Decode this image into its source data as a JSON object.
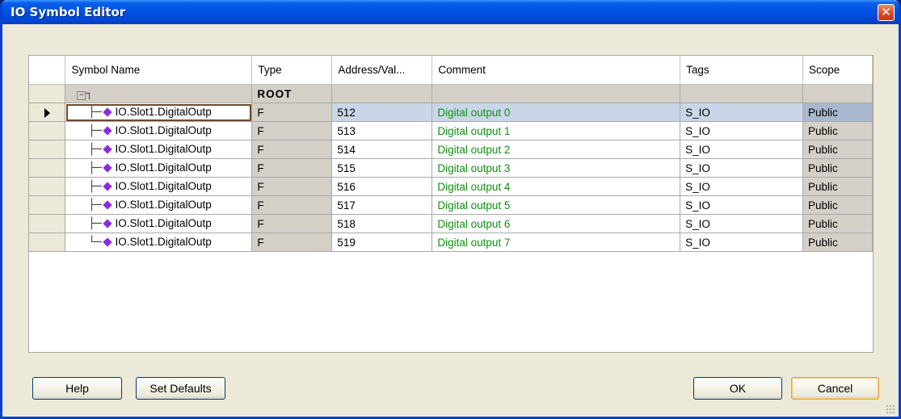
{
  "window": {
    "title": "IO Symbol Editor",
    "close_glyph": "✕"
  },
  "columns": [
    "Symbol Name",
    "Type",
    "Address/Val...",
    "Comment",
    "Tags",
    "Scope"
  ],
  "root": {
    "type": "ROOT",
    "expander_icon": "tree-collapse-icon"
  },
  "rows": [
    {
      "name": "IO.Slot1.DigitalOutp",
      "type": "F",
      "address": "512",
      "comment": "Digital output 0",
      "tags": "S_IO",
      "scope": "Public",
      "selected": true
    },
    {
      "name": "IO.Slot1.DigitalOutp",
      "type": "F",
      "address": "513",
      "comment": "Digital output 1",
      "tags": "S_IO",
      "scope": "Public"
    },
    {
      "name": "IO.Slot1.DigitalOutp",
      "type": "F",
      "address": "514",
      "comment": "Digital output 2",
      "tags": "S_IO",
      "scope": "Public"
    },
    {
      "name": "IO.Slot1.DigitalOutp",
      "type": "F",
      "address": "515",
      "comment": "Digital output 3",
      "tags": "S_IO",
      "scope": "Public"
    },
    {
      "name": "IO.Slot1.DigitalOutp",
      "type": "F",
      "address": "516",
      "comment": "Digital output 4",
      "tags": "S_IO",
      "scope": "Public"
    },
    {
      "name": "IO.Slot1.DigitalOutp",
      "type": "F",
      "address": "517",
      "comment": "Digital output 5",
      "tags": "S_IO",
      "scope": "Public"
    },
    {
      "name": "IO.Slot1.DigitalOutp",
      "type": "F",
      "address": "518",
      "comment": "Digital output 6",
      "tags": "S_IO",
      "scope": "Public"
    },
    {
      "name": "IO.Slot1.DigitalOutp",
      "type": "F",
      "address": "519",
      "comment": "Digital output 7",
      "tags": "S_IO",
      "scope": "Public"
    }
  ],
  "buttons": {
    "help": "Help",
    "set_defaults": "Set Defaults",
    "ok": "OK",
    "cancel": "Cancel"
  },
  "colors": {
    "comment_text": "#109010",
    "selection": "#c9d6e8",
    "titlebar": "#0054e3"
  }
}
